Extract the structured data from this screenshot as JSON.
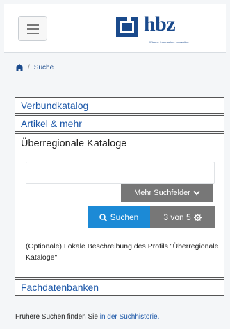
{
  "header": {
    "logo_text": "hbz",
    "logo_tagline": "Wissen. Information. Innovation.",
    "brand_color": "#1a4a8c"
  },
  "breadcrumb": {
    "home_icon": "home-icon",
    "separator": "/",
    "current": "Suche"
  },
  "panels": {
    "verbund": "Verbundkatalog",
    "artikel": "Artikel & mehr",
    "ueberregional": {
      "title": "Überregionale Kataloge",
      "search": {
        "value": "",
        "placeholder": ""
      },
      "more_fields_label": "Mehr Suchfelder",
      "search_button_label": "Suchen",
      "count_label": "3 von 5",
      "description": "(Optionale) Lokale Beschreibung des Profils \"Überregionale Kataloge\""
    },
    "fachdaten": "Fachdatenbanken"
  },
  "footer": {
    "prefix": "Frühere Suchen finden Sie",
    "link": "in der Suchhistorie."
  },
  "colors": {
    "primary_button": "#1c8ad6",
    "secondary_button": "#777777",
    "link": "#1a56a8"
  }
}
